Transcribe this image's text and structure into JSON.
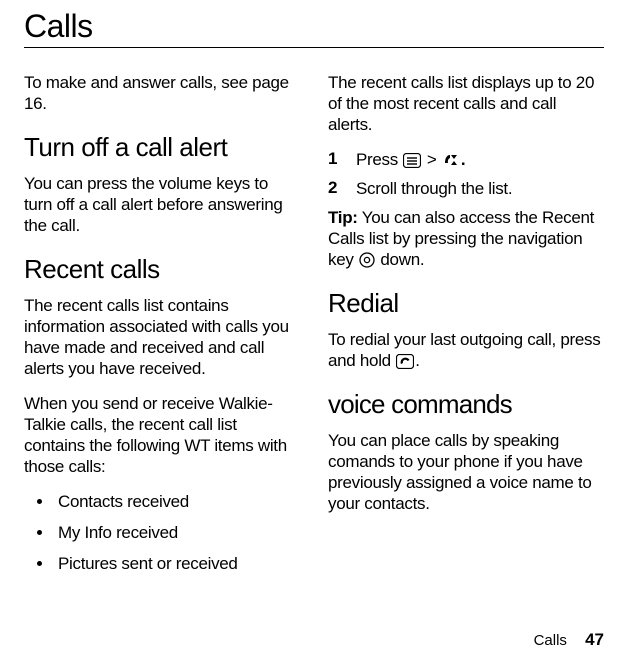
{
  "title": "Calls",
  "left": {
    "intro": "To make and answer calls, see page 16.",
    "h_turnoff": "Turn off a call alert",
    "turnoff_body": "You can press the volume keys to turn off a call alert before answering the call.",
    "h_recent": "Recent calls",
    "recent_p1": "The recent calls list contains information associated with calls you have made and received and call alerts you have received.",
    "recent_p2": "When you send or receive Walkie-Talkie calls, the recent call list contains the following WT items with those calls:",
    "bullets": [
      "Contacts received",
      "My Info received",
      "Pictures sent or received"
    ]
  },
  "right": {
    "recent_top": "The recent calls list displays up to 20 of the most recent calls and call alerts.",
    "step1_num": "1",
    "step1_a": "Press ",
    "step1_b": " > ",
    "step1_c": ".",
    "step2_num": "2",
    "step2": "Scroll through the list.",
    "tip_label": "Tip:",
    "tip_a": " You can also access the Recent Calls list by pressing the navigation key ",
    "tip_b": " down.",
    "h_redial": "Redial",
    "redial_a": "To redial your last outgoing call, press and hold ",
    "redial_b": ".",
    "h_voice": "voice commands",
    "voice_body": "You can place calls by speaking comands to your phone if you have previously assigned a voice name to your contacts."
  },
  "footer": {
    "section": "Calls",
    "page": "47"
  },
  "icons": {
    "menu": "menu-key-icon",
    "calls": "recent-calls-icon",
    "nav": "nav-key-icon",
    "send": "send-key-icon"
  }
}
